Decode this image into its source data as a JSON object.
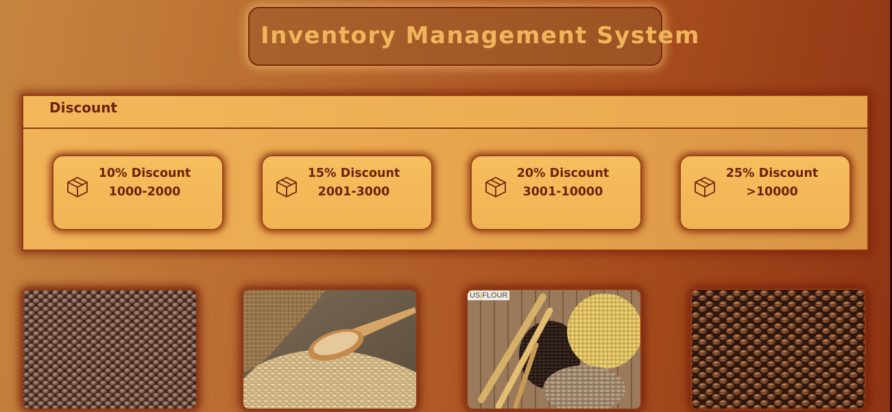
{
  "app": {
    "title": "Inventory Management System"
  },
  "discount_panel": {
    "title": "Discount",
    "cards": [
      {
        "title": "10% Discount",
        "range": "1000-2000",
        "icon": "box-icon"
      },
      {
        "title": "15% Discount",
        "range": "2001-3000",
        "icon": "box-icon"
      },
      {
        "title": "20% Discount",
        "range": "3001-10000",
        "icon": "box-icon"
      },
      {
        "title": "25% Discount",
        "range": ">10000",
        "icon": "box-icon"
      }
    ]
  },
  "products": [
    {
      "name": "lentils-image"
    },
    {
      "name": "rice-image"
    },
    {
      "name": "grains-image",
      "brand_left": "US",
      "brand_right": "FLOUR"
    },
    {
      "name": "coffee-beans-image"
    }
  ],
  "colors": {
    "title_text": "#f0b45a",
    "panel_bg": "#f1b358",
    "card_text": "#6e220c",
    "border": "#8f3a14"
  }
}
